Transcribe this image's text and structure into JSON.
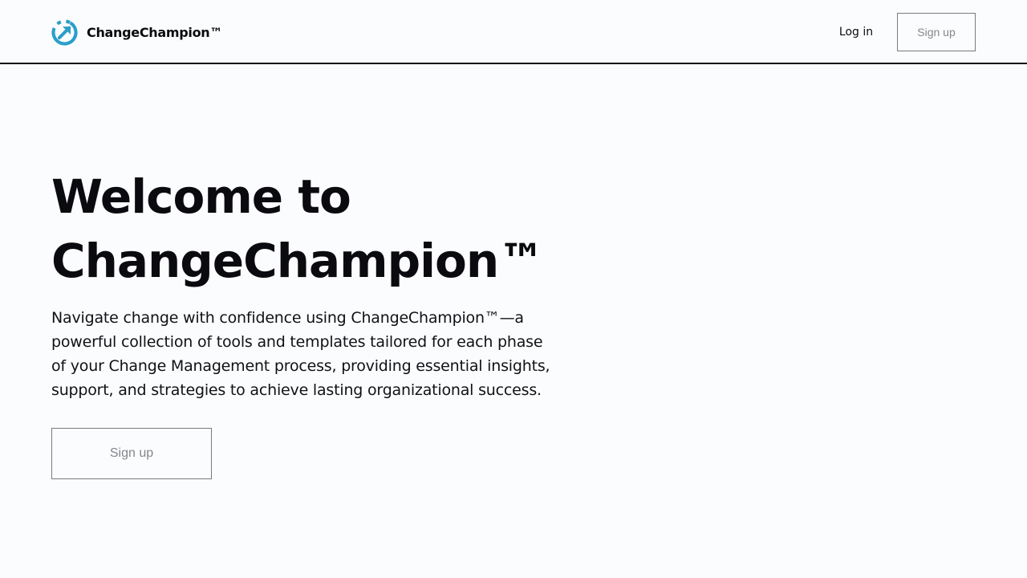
{
  "header": {
    "brand_name": "ChangeChampion™",
    "logo_icon": "circular-arrow-logo-icon",
    "login_label": "Log in",
    "signup_label": "Sign up"
  },
  "hero": {
    "title_line1": "Welcome to",
    "title_line2": "ChangeChampion™",
    "description": "Navigate change with confidence using ChangeChampion™—a powerful collection of tools and templates tailored for each phase of your Change Management process, providing essential insights, support, and strategies to achieve lasting organizational success.",
    "cta_label": "Sign up"
  },
  "colors": {
    "background": "#fbfcfe",
    "text": "#0b0b0f",
    "muted_button_text": "#86868b",
    "button_border": "#7a7a80",
    "logo_blue": "#2a9fc9"
  }
}
